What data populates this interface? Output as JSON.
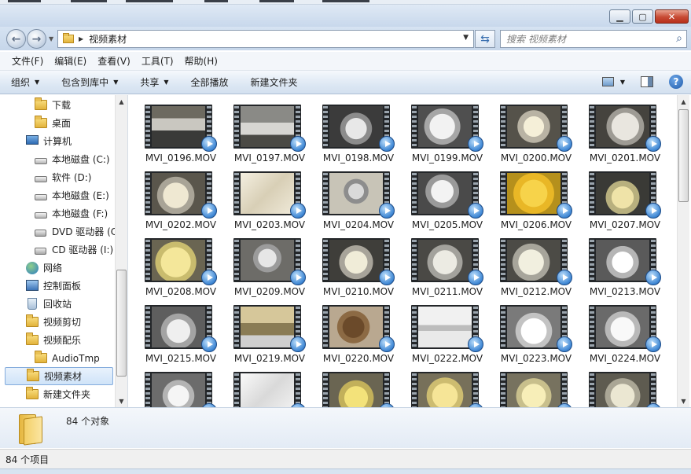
{
  "addressbar": {
    "path": "视频素材",
    "search_placeholder": "搜索 视频素材"
  },
  "menu": [
    "文件(F)",
    "编辑(E)",
    "查看(V)",
    "工具(T)",
    "帮助(H)"
  ],
  "commands": [
    {
      "label": "组织",
      "dropdown": true
    },
    {
      "label": "包含到库中",
      "dropdown": true
    },
    {
      "label": "共享",
      "dropdown": true
    },
    {
      "label": "全部播放",
      "dropdown": false
    },
    {
      "label": "新建文件夹",
      "dropdown": false
    }
  ],
  "nav_items": [
    {
      "label": "下载",
      "icon": "folder",
      "indent": 1
    },
    {
      "label": "桌面",
      "icon": "folder",
      "indent": 1
    },
    {
      "label": "计算机",
      "icon": "computer",
      "indent": 0
    },
    {
      "label": "本地磁盘 (C:)",
      "icon": "drive",
      "indent": 1
    },
    {
      "label": "软件 (D:)",
      "icon": "drive",
      "indent": 1
    },
    {
      "label": "本地磁盘 (E:)",
      "icon": "drive",
      "indent": 1
    },
    {
      "label": "本地磁盘 (F:)",
      "icon": "drive",
      "indent": 1
    },
    {
      "label": "DVD 驱动器 (C",
      "icon": "disc",
      "indent": 1
    },
    {
      "label": "CD 驱动器 (I:)",
      "icon": "disc",
      "indent": 1
    },
    {
      "label": "网络",
      "icon": "network",
      "indent": 0
    },
    {
      "label": "控制面板",
      "icon": "control-panel",
      "indent": 0
    },
    {
      "label": "回收站",
      "icon": "recycle-bin",
      "indent": 0
    },
    {
      "label": "视频剪切",
      "icon": "folder",
      "indent": 0
    },
    {
      "label": "视频配乐",
      "icon": "folder",
      "indent": 0
    },
    {
      "label": "AudioTmp",
      "icon": "folder",
      "indent": 1
    },
    {
      "label": "视频素材",
      "icon": "folder",
      "indent": 0,
      "selected": true
    },
    {
      "label": "新建文件夹",
      "icon": "folder",
      "indent": 0
    }
  ],
  "files": [
    "MVI_0196.MOV",
    "MVI_0197.MOV",
    "MVI_0198.MOV",
    "MVI_0199.MOV",
    "MVI_0200.MOV",
    "MVI_0201.MOV",
    "MVI_0202.MOV",
    "MVI_0203.MOV",
    "MVI_0204.MOV",
    "MVI_0205.MOV",
    "MVI_0206.MOV",
    "MVI_0207.MOV",
    "MVI_0208.MOV",
    "MVI_0209.MOV",
    "MVI_0210.MOV",
    "MVI_0211.MOV",
    "MVI_0212.MOV",
    "MVI_0213.MOV",
    "MVI_0215.MOV",
    "MVI_0219.MOV",
    "MVI_0220.MOV",
    "MVI_0222.MOV",
    "MVI_0223.MOV",
    "MVI_0224.MOV",
    "",
    "",
    "",
    "",
    "",
    ""
  ],
  "details": {
    "count": "84 个对象"
  },
  "status": {
    "text": "84 个项目"
  },
  "colors": {
    "accent": "#3d86d4",
    "selection": "#cfe3f8",
    "folder": "#e9c156"
  }
}
